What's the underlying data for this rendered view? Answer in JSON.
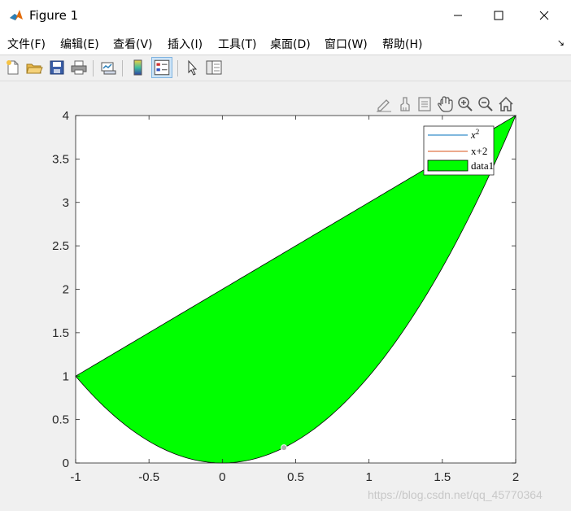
{
  "window": {
    "title": "Figure 1",
    "minimize_glyph": "—",
    "maximize_glyph": "☐",
    "close_glyph": "✕"
  },
  "menu": {
    "items": [
      {
        "label": "文件(F)"
      },
      {
        "label": "编辑(E)"
      },
      {
        "label": "查看(V)"
      },
      {
        "label": "插入(I)"
      },
      {
        "label": "工具(T)"
      },
      {
        "label": "桌面(D)"
      },
      {
        "label": "窗口(W)"
      },
      {
        "label": "帮助(H)"
      }
    ],
    "dock_arrow": "↘"
  },
  "toolbar": {
    "icons": [
      "new-file-icon",
      "open-folder-icon",
      "save-icon",
      "print-icon",
      "link-plot-icon",
      "colorbar-icon",
      "legend-icon",
      "pointer-icon",
      "property-inspector-icon"
    ]
  },
  "axes_toolbar": {
    "icons": [
      "edit-icon",
      "brush-icon",
      "data-tips-icon",
      "pan-icon",
      "zoom-in-icon",
      "zoom-out-icon",
      "home-icon"
    ]
  },
  "chart_data": {
    "type": "area",
    "title": "",
    "xlabel": "",
    "ylabel": "",
    "xlim": [
      -1,
      2
    ],
    "ylim": [
      0,
      4
    ],
    "xticks": [
      "-1",
      "-0.5",
      "0",
      "0.5",
      "1",
      "1.5",
      "2"
    ],
    "yticks": [
      "0",
      "0.5",
      "1",
      "1.5",
      "2",
      "2.5",
      "3",
      "3.5",
      "4"
    ],
    "grid": false,
    "legend_position": "top-right",
    "series": [
      {
        "name": "x²",
        "label_base": "x",
        "label_sup": "2",
        "function": "x^2",
        "color": "#0072BD"
      },
      {
        "name": "x+2",
        "function": "x+2",
        "color": "#D95319"
      },
      {
        "name": "data1",
        "type": "fill",
        "between": [
          "x^2",
          "x+2"
        ],
        "x_range": [
          -1,
          2
        ],
        "color": "#00ff00"
      }
    ],
    "marker": {
      "x": 0.42,
      "y": 0.1764,
      "color": "#b0b0b0"
    }
  },
  "watermark": "https://blog.csdn.net/qq_45770364"
}
